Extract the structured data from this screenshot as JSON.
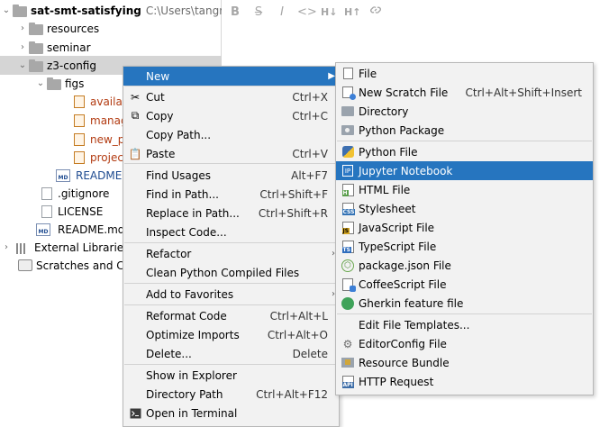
{
  "tree": {
    "root": {
      "name": "sat-smt-satisfying",
      "path": "C:\\Users\\tangr\\"
    },
    "items": [
      {
        "label": "resources"
      },
      {
        "label": "seminar"
      },
      {
        "label": "z3-config"
      },
      {
        "label": "figs"
      },
      {
        "label": "availab"
      },
      {
        "label": "manag"
      },
      {
        "label": "new_p"
      },
      {
        "label": "projec"
      },
      {
        "label": "README.m"
      },
      {
        "label": ".gitignore"
      },
      {
        "label": "LICENSE"
      },
      {
        "label": "README.md"
      },
      {
        "label": "External Libraries"
      },
      {
        "label": "Scratches and Co"
      }
    ]
  },
  "editor_toolbar": [
    "B",
    "S",
    "I",
    "<>",
    "H↓",
    "H↑",
    "link"
  ],
  "context_menu": {
    "items": [
      {
        "label": "New",
        "shortcut": ""
      },
      {
        "label": "Cut",
        "shortcut": "Ctrl+X"
      },
      {
        "label": "Copy",
        "shortcut": "Ctrl+C"
      },
      {
        "label": "Copy Path...",
        "shortcut": ""
      },
      {
        "label": "Paste",
        "shortcut": "Ctrl+V"
      },
      {
        "label": "Find Usages",
        "shortcut": "Alt+F7"
      },
      {
        "label": "Find in Path...",
        "shortcut": "Ctrl+Shift+F"
      },
      {
        "label": "Replace in Path...",
        "shortcut": "Ctrl+Shift+R"
      },
      {
        "label": "Inspect Code...",
        "shortcut": ""
      },
      {
        "label": "Refactor",
        "shortcut": ""
      },
      {
        "label": "Clean Python Compiled Files",
        "shortcut": ""
      },
      {
        "label": "Add to Favorites",
        "shortcut": ""
      },
      {
        "label": "Reformat Code",
        "shortcut": "Ctrl+Alt+L"
      },
      {
        "label": "Optimize Imports",
        "shortcut": "Ctrl+Alt+O"
      },
      {
        "label": "Delete...",
        "shortcut": "Delete"
      },
      {
        "label": "Show in Explorer",
        "shortcut": ""
      },
      {
        "label": "Directory Path",
        "shortcut": "Ctrl+Alt+F12"
      },
      {
        "label": "Open in Terminal",
        "shortcut": ""
      }
    ]
  },
  "new_submenu": {
    "highlighted": "Jupyter Notebook",
    "items": [
      {
        "label": "File",
        "shortcut": ""
      },
      {
        "label": "New Scratch File",
        "shortcut": "Ctrl+Alt+Shift+Insert"
      },
      {
        "label": "Directory",
        "shortcut": ""
      },
      {
        "label": "Python Package",
        "shortcut": ""
      },
      {
        "label": "Python File",
        "shortcut": ""
      },
      {
        "label": "Jupyter Notebook",
        "shortcut": ""
      },
      {
        "label": "HTML File",
        "shortcut": ""
      },
      {
        "label": "Stylesheet",
        "shortcut": ""
      },
      {
        "label": "JavaScript File",
        "shortcut": ""
      },
      {
        "label": "TypeScript File",
        "shortcut": ""
      },
      {
        "label": "package.json File",
        "shortcut": ""
      },
      {
        "label": "CoffeeScript File",
        "shortcut": ""
      },
      {
        "label": "Gherkin feature file",
        "shortcut": ""
      },
      {
        "label": "Edit File Templates...",
        "shortcut": ""
      },
      {
        "label": "EditorConfig File",
        "shortcut": ""
      },
      {
        "label": "Resource Bundle",
        "shortcut": ""
      },
      {
        "label": "HTTP Request",
        "shortcut": ""
      }
    ]
  },
  "colors": {
    "highlight": "#2675bf",
    "menu_bg": "#f2f2f2",
    "selected_row": "#d5d5d5"
  }
}
